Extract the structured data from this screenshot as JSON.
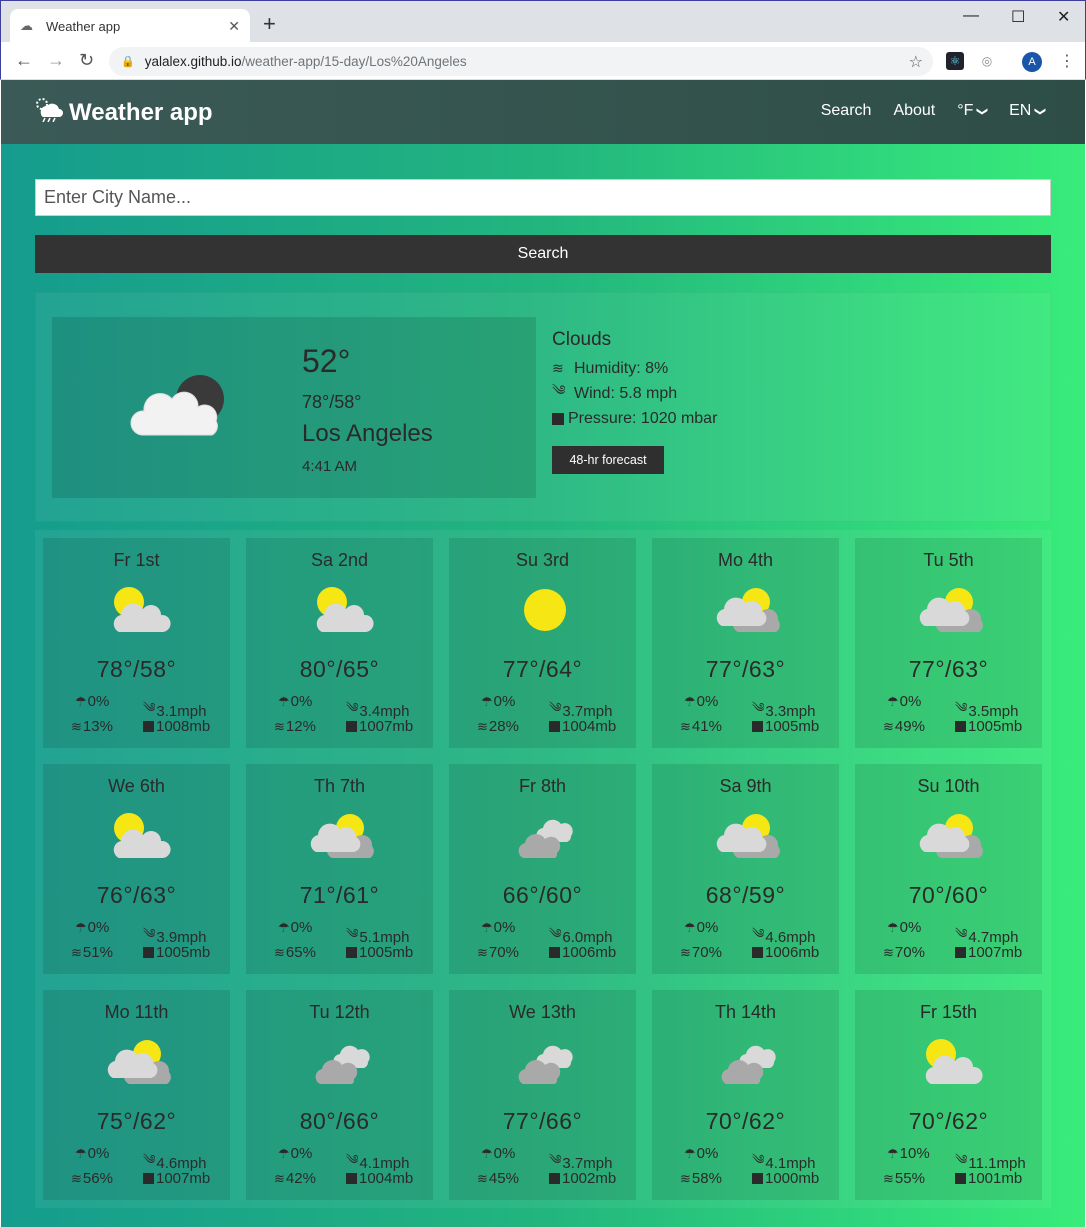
{
  "browser": {
    "tab_title": "Weather app",
    "url_domain": "yalalex.github.io",
    "url_path": "/weather-app/15-day/Los%20Angeles",
    "avatar_letter": "A"
  },
  "nav": {
    "brand": "Weather app",
    "links": [
      "Search",
      "About",
      "°F",
      "EN"
    ]
  },
  "search": {
    "placeholder": "Enter City Name...",
    "button_label": "Search"
  },
  "current": {
    "temp": "52°",
    "hilo": "78°/58°",
    "city": "Los Angeles",
    "time": "4:41 AM",
    "condition": "Clouds",
    "humidity": "Humidity: 8%",
    "wind": "Wind: 5.8 mph",
    "pressure": "Pressure: 1020 mbar",
    "forecast_button": "48-hr forecast",
    "icon": "night-cloud-icon"
  },
  "days": [
    {
      "name": "Fr 1st",
      "temp": "78°/58°",
      "precip": "0%",
      "wind": "3.1mph",
      "humidity": "13%",
      "pressure": "1008mb",
      "icon": "sun-cloud"
    },
    {
      "name": "Sa 2nd",
      "temp": "80°/65°",
      "precip": "0%",
      "wind": "3.4mph",
      "humidity": "12%",
      "pressure": "1007mb",
      "icon": "sun-cloud"
    },
    {
      "name": "Su 3rd",
      "temp": "77°/64°",
      "precip": "0%",
      "wind": "3.7mph",
      "humidity": "28%",
      "pressure": "1004mb",
      "icon": "sun"
    },
    {
      "name": "Mo 4th",
      "temp": "77°/63°",
      "precip": "0%",
      "wind": "3.3mph",
      "humidity": "41%",
      "pressure": "1005mb",
      "icon": "cloud-sun"
    },
    {
      "name": "Tu 5th",
      "temp": "77°/63°",
      "precip": "0%",
      "wind": "3.5mph",
      "humidity": "49%",
      "pressure": "1005mb",
      "icon": "cloud-sun"
    },
    {
      "name": "We 6th",
      "temp": "76°/63°",
      "precip": "0%",
      "wind": "3.9mph",
      "humidity": "51%",
      "pressure": "1005mb",
      "icon": "sun-cloud"
    },
    {
      "name": "Th 7th",
      "temp": "71°/61°",
      "precip": "0%",
      "wind": "5.1mph",
      "humidity": "65%",
      "pressure": "1005mb",
      "icon": "cloud-sun"
    },
    {
      "name": "Fr 8th",
      "temp": "66°/60°",
      "precip": "0%",
      "wind": "6.0mph",
      "humidity": "70%",
      "pressure": "1006mb",
      "icon": "clouds"
    },
    {
      "name": "Sa 9th",
      "temp": "68°/59°",
      "precip": "0%",
      "wind": "4.6mph",
      "humidity": "70%",
      "pressure": "1006mb",
      "icon": "cloud-sun"
    },
    {
      "name": "Su 10th",
      "temp": "70°/60°",
      "precip": "0%",
      "wind": "4.7mph",
      "humidity": "70%",
      "pressure": "1007mb",
      "icon": "cloud-sun"
    },
    {
      "name": "Mo 11th",
      "temp": "75°/62°",
      "precip": "0%",
      "wind": "4.6mph",
      "humidity": "56%",
      "pressure": "1007mb",
      "icon": "cloud-sun"
    },
    {
      "name": "Tu 12th",
      "temp": "80°/66°",
      "precip": "0%",
      "wind": "4.1mph",
      "humidity": "42%",
      "pressure": "1004mb",
      "icon": "clouds"
    },
    {
      "name": "We 13th",
      "temp": "77°/66°",
      "precip": "0%",
      "wind": "3.7mph",
      "humidity": "45%",
      "pressure": "1002mb",
      "icon": "clouds"
    },
    {
      "name": "Th 14th",
      "temp": "70°/62°",
      "precip": "0%",
      "wind": "4.1mph",
      "humidity": "58%",
      "pressure": "1000mb",
      "icon": "clouds"
    },
    {
      "name": "Fr 15th",
      "temp": "70°/62°",
      "precip": "10%",
      "wind": "11.1mph",
      "humidity": "55%",
      "pressure": "1001mb",
      "icon": "sun-cloud"
    }
  ],
  "colors": {
    "nav_bg": "#3b5a57",
    "sun": "#f5e614",
    "cloud_light": "#d9d9d9",
    "cloud_dark": "#a9a9a9",
    "button_dark": "#333333"
  }
}
